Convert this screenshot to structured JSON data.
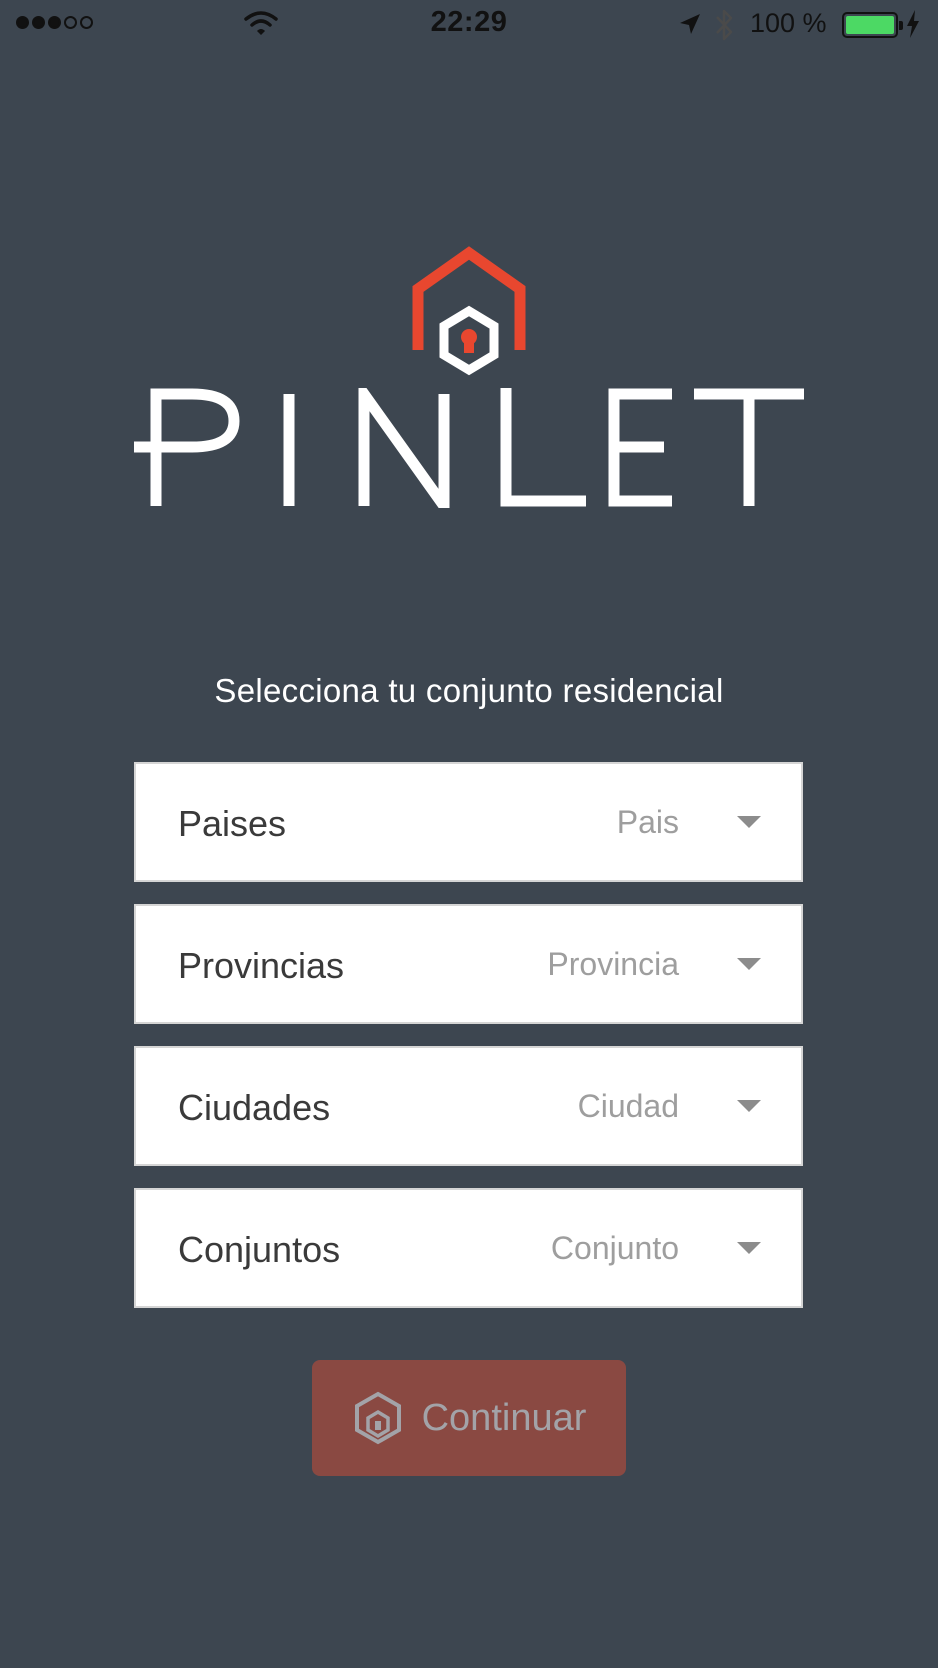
{
  "status_bar": {
    "time": "22:29",
    "battery_percent": "100 %",
    "signal_filled": 3,
    "signal_total": 5,
    "battery_level": 1.0,
    "icons": [
      "signal-dots-icon",
      "wifi-icon",
      "location-arrow-icon",
      "bluetooth-icon",
      "battery-icon",
      "charging-bolt-icon"
    ]
  },
  "brand": {
    "name": "PINLET",
    "accent_color": "#e8472f",
    "background_color": "#3d4650"
  },
  "form": {
    "title": "Selecciona tu conjunto residencial",
    "fields": [
      {
        "label": "Paises",
        "placeholder": "Pais"
      },
      {
        "label": "Provincias",
        "placeholder": "Provincia"
      },
      {
        "label": "Ciudades",
        "placeholder": "Ciudad"
      },
      {
        "label": "Conjuntos",
        "placeholder": "Conjunto"
      }
    ],
    "continue_label": "Continuar",
    "continue_icon": "home-lock-icon"
  }
}
